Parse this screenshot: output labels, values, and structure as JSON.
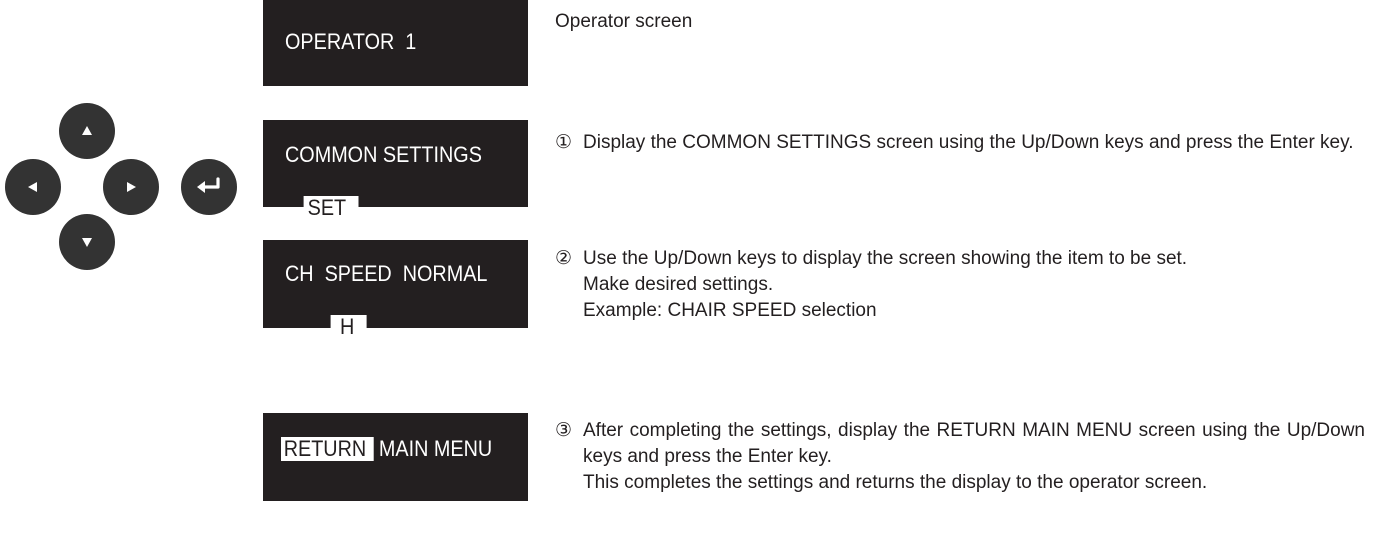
{
  "keypad": {
    "up_icon": "triangle-up-icon",
    "left_icon": "triangle-left-icon",
    "right_icon": "triangle-right-icon",
    "down_icon": "triangle-down-icon",
    "enter_icon": "enter-return-icon",
    "key_color": "#333333"
  },
  "screens": {
    "operator": {
      "line1": "OPERATOR  1"
    },
    "common_settings": {
      "line1": "COMMON SETTINGS",
      "line2_highlight": "SET"
    },
    "ch_speed": {
      "line1": "CH  SPEED  NORMAL",
      "line2_highlight": "H"
    },
    "return_menu": {
      "highlight": "RETURN",
      "rest": "MAIN MENU"
    }
  },
  "descriptions": {
    "operator": "Operator screen",
    "step1": {
      "num": "①",
      "text": "Display the COMMON SETTINGS screen using the Up/Down keys and press the Enter key."
    },
    "step2": {
      "num": "②",
      "text1": "Use the Up/Down keys to display the screen showing the item to be set.",
      "text2": "Make desired settings.",
      "text3": "Example: CHAIR SPEED selection"
    },
    "step3": {
      "num": "③",
      "text1": "After completing the settings, display the RETURN MAIN MENU screen using the Up/Down keys and press the Enter key.",
      "text2": "This completes the settings and returns the display to the operator screen."
    }
  },
  "colors": {
    "lcd_background": "#231f20",
    "lcd_text": "#ffffff",
    "body_text": "#231f20"
  }
}
